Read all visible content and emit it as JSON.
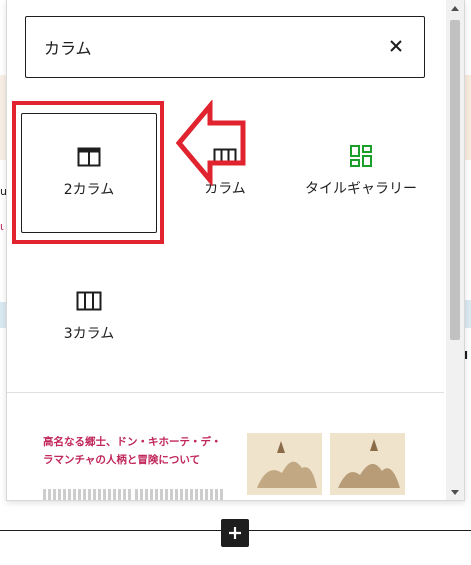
{
  "search": {
    "value": "カラム",
    "placeholder": ""
  },
  "blocks": [
    {
      "label": "2カラム",
      "icon": "two-columns-icon"
    },
    {
      "label": "カラム",
      "icon": "columns-icon"
    },
    {
      "label": "タイルギャラリー",
      "icon": "tiled-gallery-icon"
    },
    {
      "label": "3カラム",
      "icon": "three-columns-icon"
    }
  ],
  "preview": {
    "title": "高名なる郷士、ドン・キホーテ・デ・ラマンチャの人柄と冒険について"
  },
  "colors": {
    "highlight": "#e0232e",
    "tile_gallery_icon": "#1aa02a",
    "preview_title": "#c0265a",
    "text": "#1e1e1e"
  },
  "background_marks": [
    "u",
    "ι",
    "I"
  ]
}
